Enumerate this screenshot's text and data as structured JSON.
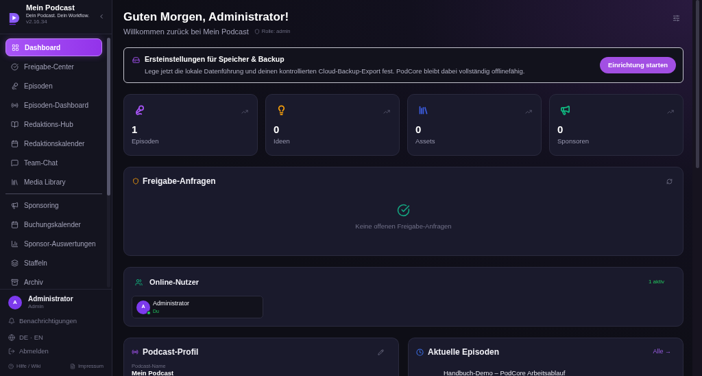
{
  "sidebar": {
    "app_name": "Mein Podcast",
    "tagline": "Dein Podcast. Dein Workflow.",
    "version": "v2.16.34",
    "nav_groups": [
      {
        "items": [
          {
            "label": "Dashboard",
            "selected": true
          },
          {
            "label": "Freigabe-Center",
            "selected": false
          },
          {
            "label": "Episoden",
            "selected": false
          },
          {
            "label": "Episoden-Dashboard",
            "selected": false
          },
          {
            "label": "Redaktions-Hub",
            "selected": false
          },
          {
            "label": "Redaktionskalender",
            "selected": false
          },
          {
            "label": "Team-Chat",
            "selected": false
          },
          {
            "label": "Media Library",
            "selected": false
          }
        ]
      },
      {
        "items": [
          {
            "label": "Sponsoring",
            "selected": false
          },
          {
            "label": "Buchungskalender",
            "selected": false
          },
          {
            "label": "Sponsor-Auswertungen",
            "selected": false
          },
          {
            "label": "Staffeln",
            "selected": false
          },
          {
            "label": "Archiv",
            "selected": false
          }
        ]
      }
    ],
    "user": {
      "initial": "A",
      "name": "Administrator",
      "role": "Admin"
    },
    "links": [
      "Benachrichtigungen",
      "DE · EN",
      "Abmelden"
    ],
    "footer_links": [
      "Hilfe / Wiki",
      "Impressum"
    ]
  },
  "header": {
    "title": "Guten Morgen, Administrator!",
    "subtitle": "Willkommen zurück bei Mein Podcast",
    "role": "Rolle: admin"
  },
  "setup_banner": {
    "title": "Ersteinstellungen für Speicher & Backup",
    "text": "Lege jetzt die lokale Datenführung und deinen kontrollierten Cloud-Backup-Export fest. PodCore bleibt dabei vollständig offlinefähig.",
    "button": "Einrichtung starten"
  },
  "stats": [
    {
      "value": "1",
      "label": "Episoden",
      "color": "#a855f7"
    },
    {
      "value": "0",
      "label": "Ideen",
      "color": "#f59e0b"
    },
    {
      "value": "0",
      "label": "Assets",
      "color": "#3b5bdb"
    },
    {
      "value": "0",
      "label": "Sponsoren",
      "color": "#10b981"
    }
  ],
  "approval_requests": {
    "title": "Freigabe-Anfragen",
    "empty_text": "Keine offenen Freigabe-Anfragen"
  },
  "online_users": {
    "title": "Online-Nutzer",
    "count": "1 aktiv",
    "users": [
      {
        "initial": "A",
        "name": "Administrator",
        "note": "Du",
        "online": true
      }
    ]
  },
  "podcast_profile": {
    "title": "Podcast-Profil",
    "field_label": "Podcast-Name",
    "field_value": "Mein Podcast"
  },
  "recent_episodes": {
    "title": "Aktuelle Episoden",
    "link": "Alle →",
    "episodes": [
      {
        "title": "Handbuch-Demo – PodCore Arbeitsablauf"
      }
    ]
  }
}
